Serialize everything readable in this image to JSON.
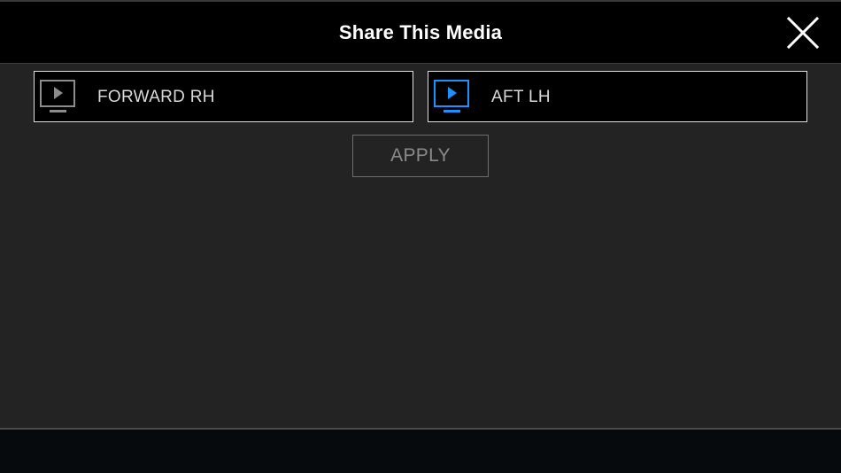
{
  "header": {
    "title": "Share This Media",
    "close_icon": "close-icon"
  },
  "devices": [
    {
      "label": "FORWARD RH",
      "icon": "screen-play-icon",
      "selected": false,
      "icon_color": "#8c8c8c"
    },
    {
      "label": "AFT LH",
      "icon": "screen-play-icon",
      "selected": true,
      "icon_color": "#1e90ff"
    }
  ],
  "actions": {
    "apply_label": "APPLY"
  },
  "colors": {
    "background": "#232323",
    "header_bg": "#000000",
    "accent": "#1e90ff",
    "disabled_text": "#8a8a8a"
  }
}
